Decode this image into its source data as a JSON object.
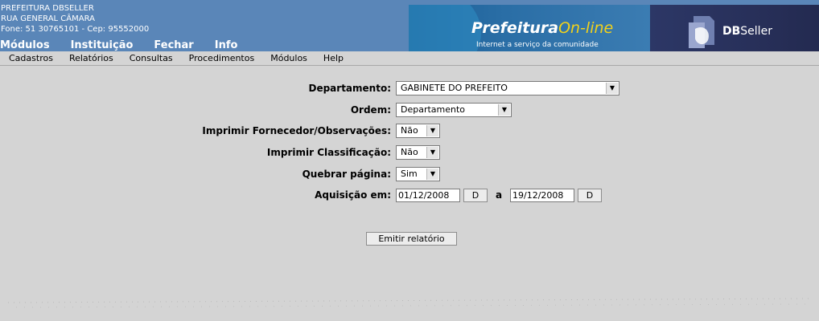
{
  "header": {
    "org_name": "PREFEITURA DBSELLER",
    "org_street": "RUA GENERAL CÂMARA",
    "org_contact": "Fone: 51 30765101  -  Cep: 95552000",
    "top_menu": [
      "Módulos",
      "Instituição",
      "Fechar",
      "Info"
    ],
    "logo_prefeitura": "Prefeitura",
    "logo_online": "On-line",
    "logo_tagline": "Internet a serviço da comunidade",
    "logo_db_bold": "DB",
    "logo_db_rest": "Seller"
  },
  "sub_menu": [
    "Cadastros",
    "Relatórios",
    "Consultas",
    "Procedimentos",
    "Módulos",
    "Help"
  ],
  "form": {
    "departamento": {
      "label": "Departamento:",
      "value": "GABINETE DO PREFEITO"
    },
    "ordem": {
      "label": "Ordem:",
      "value": "Departamento"
    },
    "imprimir_fornecedor": {
      "label": "Imprimir Fornecedor/Observações:",
      "value": "Não"
    },
    "imprimir_classificacao": {
      "label": "Imprimir Classificação:",
      "value": "Não"
    },
    "quebrar_pagina": {
      "label": "Quebrar página:",
      "value": "Sim"
    },
    "aquisicao": {
      "label": "Aquisição em:",
      "date_start": "01/12/2008",
      "date_end": "19/12/2008",
      "separator": "a",
      "date_button": "D"
    },
    "emit_button": "Emitir relatório"
  },
  "colors": {
    "header_bg": "#5a86b8",
    "page_bg": "#d4d4d4",
    "online_yellow": "#f3d21a",
    "dbseller_bg": "#28305a"
  },
  "icons": {
    "select_arrow": "chevron-down-icon",
    "dbseller_logo": "dbseller-logo-icon"
  }
}
